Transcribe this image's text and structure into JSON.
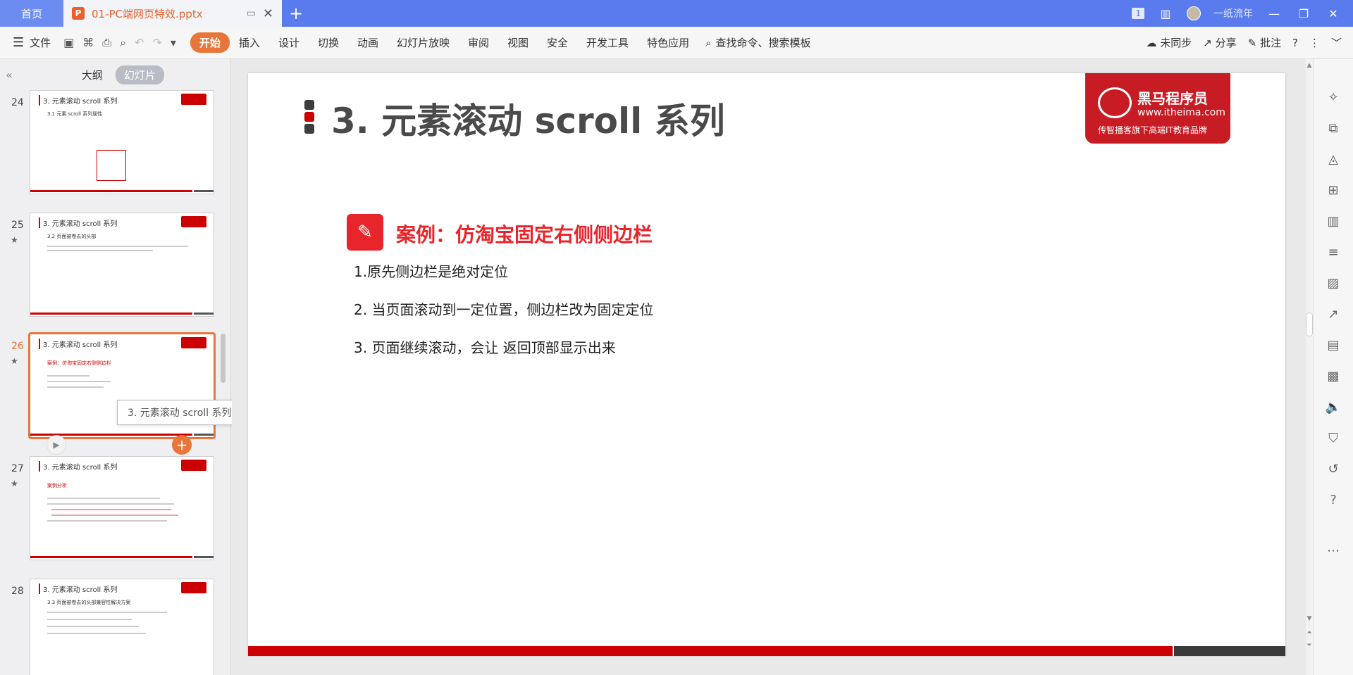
{
  "titlebar": {
    "home_tab": "首页",
    "doc_tab": "01-PC端网页特效.pptx",
    "badge": "1",
    "user": "一纸流年"
  },
  "ribbon": {
    "file_menu": "文件",
    "tabs": [
      "开始",
      "插入",
      "设计",
      "切换",
      "动画",
      "幻灯片放映",
      "审阅",
      "视图",
      "安全",
      "开发工具",
      "特色应用"
    ],
    "search": "查找命令、搜索模板",
    "sync": "未同步",
    "share": "分享",
    "comment": "批注"
  },
  "left_panel": {
    "outline_tab": "大纲",
    "slides_tab": "幻灯片",
    "tooltip": "3. 元素滚动 scroll 系列",
    "thumbs": [
      {
        "num": "24",
        "title": "3. 元素滚动 scroll 系列",
        "sub": "3.1 元素 scroll 系列属性"
      },
      {
        "num": "25",
        "title": "3. 元素滚动 scroll 系列",
        "sub": "3.2 页面被卷去的头部"
      },
      {
        "num": "26",
        "title": "3. 元素滚动 scroll 系列",
        "sub": "案例：仿淘宝固定右侧侧边栏"
      },
      {
        "num": "27",
        "title": "3. 元素滚动 scroll 系列",
        "sub": "案例分析"
      },
      {
        "num": "28",
        "title": "3. 元素滚动 scroll 系列",
        "sub": "3.3 页面被卷去的头部兼容性解决方案"
      }
    ]
  },
  "slide": {
    "title": "3. 元素滚动 scroll 系列",
    "brand_name": "黑马程序员",
    "brand_url": "www.itheima.com",
    "brand_slogan": "传智播客旗下高端IT教育品牌",
    "case_title": "案例：仿淘宝固定右侧侧边栏",
    "items": [
      "1.原先侧边栏是绝对定位",
      "2. 当页面滚动到一定位置，侧边栏改为固定定位",
      "3. 页面继续滚动，会让 返回顶部显示出来"
    ]
  }
}
